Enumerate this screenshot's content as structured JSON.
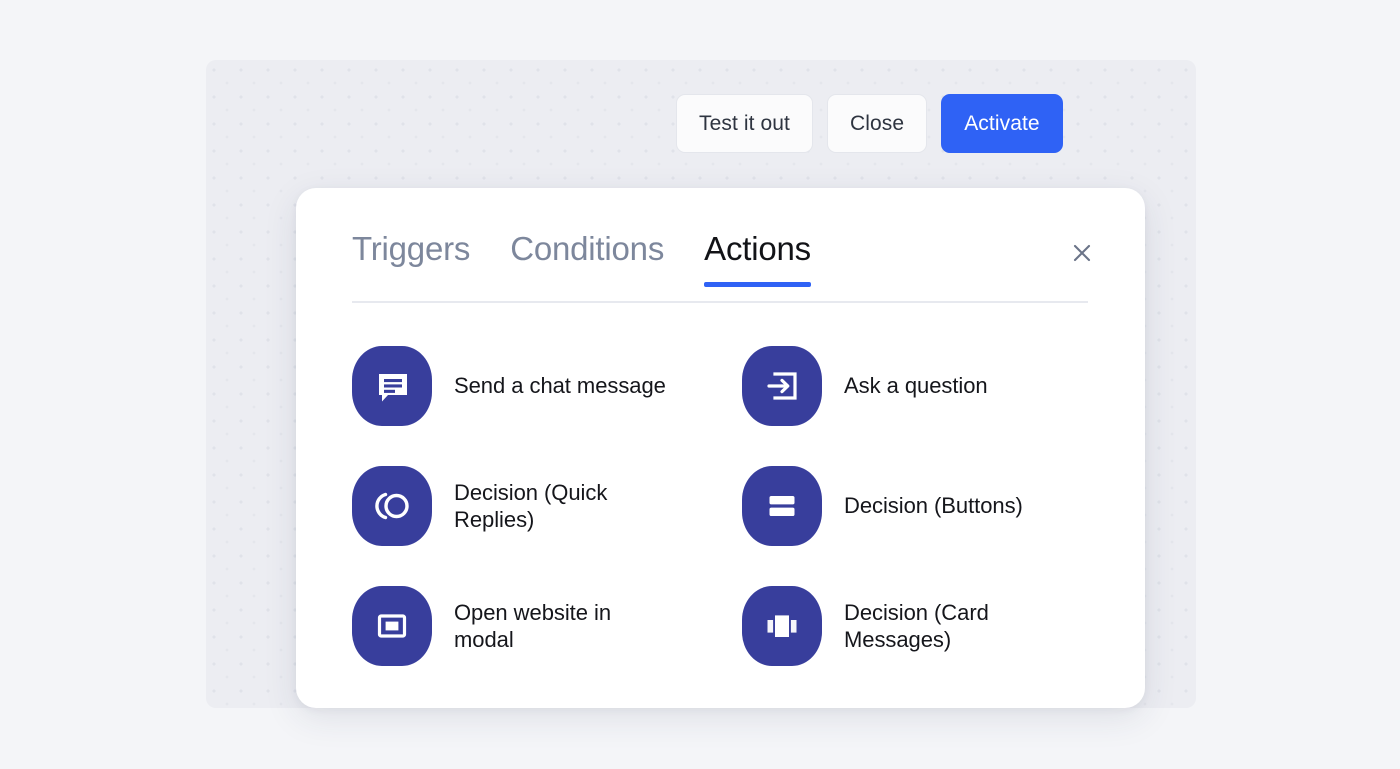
{
  "colors": {
    "accent_blue": "#2f62f5",
    "tile_indigo": "#383e9c",
    "page_bg": "#f4f5f8",
    "canvas_bg": "#ecedf2",
    "tab_inactive": "#7d879c",
    "tab_active": "#121317"
  },
  "toolbar": {
    "test_label": "Test it out",
    "close_label": "Close",
    "activate_label": "Activate"
  },
  "modal": {
    "close_icon": "close-icon",
    "tabs": [
      {
        "label": "Triggers",
        "active": false
      },
      {
        "label": "Conditions",
        "active": false
      },
      {
        "label": "Actions",
        "active": true
      }
    ],
    "actions": [
      {
        "label": "Send a chat message",
        "icon": "chat-message-icon"
      },
      {
        "label": "Ask a question",
        "icon": "arrow-into-box-icon"
      },
      {
        "label": "Decision (Quick Replies)",
        "icon": "quick-replies-icon"
      },
      {
        "label": "Decision (Buttons)",
        "icon": "stacked-buttons-icon"
      },
      {
        "label": "Open website in modal",
        "icon": "modal-window-icon"
      },
      {
        "label": "Decision (Card Messages)",
        "icon": "card-carousel-icon"
      }
    ]
  }
}
